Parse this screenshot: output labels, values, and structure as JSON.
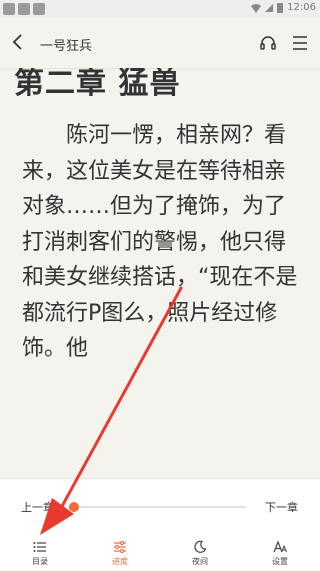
{
  "status_bar": {
    "time": "12:06"
  },
  "header": {
    "title": "一号狂兵"
  },
  "content": {
    "chapter_title": "第二章 猛兽",
    "paragraph": "陈河一愣，相亲网？看来，这位美女是在等待相亲对象……但为了掩饰，为了打消刺客们的警惕，他只得和美女继续搭话，“现在不是都流行P图么，照片经过修饰。他"
  },
  "panel": {
    "prev_chapter": "上一章",
    "next_chapter": "下一章",
    "progress": 0.02,
    "tabs": [
      {
        "label": "目录",
        "icon": "list-icon",
        "active": false
      },
      {
        "label": "进度",
        "icon": "progress-sliders-icon",
        "active": true
      },
      {
        "label": "夜间",
        "icon": "moon-icon",
        "active": false
      },
      {
        "label": "设置",
        "icon": "font-settings-icon",
        "active": false
      }
    ]
  },
  "colors": {
    "accent": "#f26a3d",
    "annotation": "#e83a2f",
    "background": "#f5f3ee"
  }
}
